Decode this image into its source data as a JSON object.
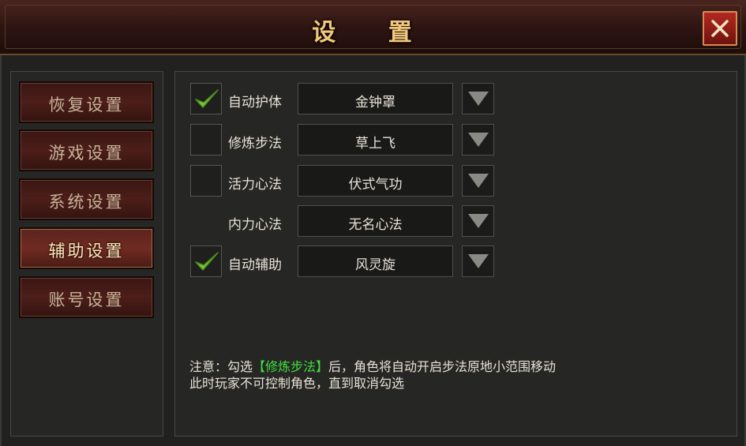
{
  "dialog": {
    "title": "设 置",
    "close_icon": "close-icon"
  },
  "nav": {
    "items": [
      {
        "label": "恢复设置",
        "active": false
      },
      {
        "label": "游戏设置",
        "active": false
      },
      {
        "label": "系统设置",
        "active": false
      },
      {
        "label": "辅助设置",
        "active": true
      },
      {
        "label": "账号设置",
        "active": false
      }
    ]
  },
  "settings": {
    "rows": [
      {
        "label": "自动护体",
        "checked": true,
        "has_checkbox": true,
        "value": "金钟罩"
      },
      {
        "label": "修炼步法",
        "checked": false,
        "has_checkbox": true,
        "value": "草上飞"
      },
      {
        "label": "活力心法",
        "checked": false,
        "has_checkbox": true,
        "value": "伏式气功"
      },
      {
        "label": "内力心法",
        "checked": false,
        "has_checkbox": false,
        "value": "无名心法"
      },
      {
        "label": "自动辅助",
        "checked": true,
        "has_checkbox": true,
        "value": "风灵旋"
      }
    ]
  },
  "note": {
    "prefix": "注意：勾选",
    "highlight": "【修炼步法】",
    "suffix": "后，角色将自动开启步法原地小范围移动",
    "line2": "此时玩家不可控制角色，直到取消勾选"
  },
  "colors": {
    "title": "#f3c77b",
    "highlight": "#3fe03f",
    "checkmark": "#7bc93a"
  }
}
